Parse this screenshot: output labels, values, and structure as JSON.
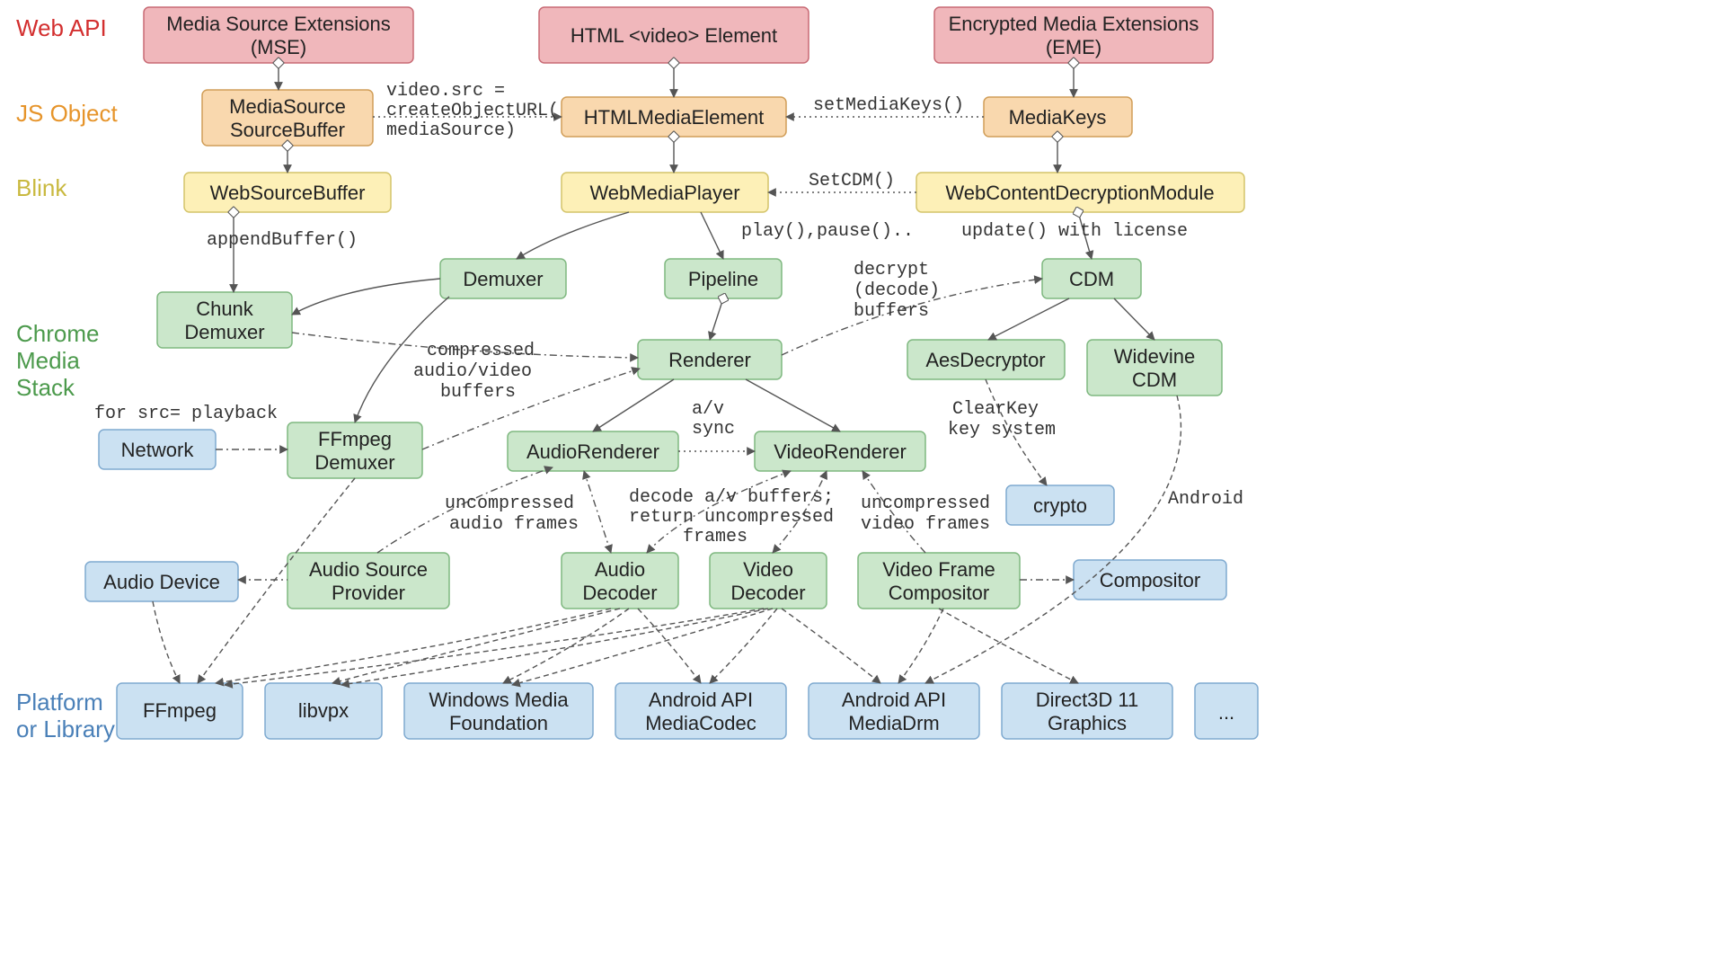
{
  "layers": {
    "webapi": "Web API",
    "jsobj": "JS Object",
    "blink": "Blink",
    "cms1": "Chrome",
    "cms2": "Media",
    "cms3": "Stack",
    "plat1": "Platform",
    "plat2": "or Library"
  },
  "boxes": {
    "mse1": "Media Source Extensions",
    "mse2": "(MSE)",
    "video": "HTML <video> Element",
    "eme1": "Encrypted Media Extensions",
    "eme2": "(EME)",
    "mssb1": "MediaSource",
    "mssb2": "SourceBuffer",
    "hme": "HTMLMediaElement",
    "mk": "MediaKeys",
    "wsb": "WebSourceBuffer",
    "wmp": "WebMediaPlayer",
    "wcdm": "WebContentDecryptionModule",
    "chunk1": "Chunk",
    "chunk2": "Demuxer",
    "demux": "Demuxer",
    "pipe": "Pipeline",
    "cdm": "CDM",
    "render": "Renderer",
    "aesd": "AesDecryptor",
    "wvcdm1": "Widevine",
    "wvcdm2": "CDM",
    "net": "Network",
    "ffdmx1": "FFmpeg",
    "ffdmx2": "Demuxer",
    "arend": "AudioRenderer",
    "vrend": "VideoRenderer",
    "crypto": "crypto",
    "adev": "Audio Device",
    "asp1": "Audio Source",
    "asp2": "Provider",
    "adec1": "Audio",
    "adec2": "Decoder",
    "vdec1": "Video",
    "vdec2": "Decoder",
    "vfc1": "Video Frame",
    "vfc2": "Compositor",
    "comp": "Compositor",
    "ffmpeg": "FFmpeg",
    "libvpx": "libvpx",
    "wmf1": "Windows Media",
    "wmf2": "Foundation",
    "amc1": "Android API",
    "amc2": "MediaCodec",
    "amd1": "Android API",
    "amd2": "MediaDrm",
    "d3d1": "Direct3D 11",
    "d3d2": "Graphics",
    "more": "..."
  },
  "edges": {
    "vsrc1": "video.src =",
    "vsrc2": "createObjectURL(",
    "vsrc3": "mediaSource)",
    "smk": "setMediaKeys()",
    "setcdm": "SetCDM()",
    "appendbuf": "appendBuffer()",
    "playpause": "play(),pause()..",
    "updlic": "update() with license",
    "srcplay": "for src= playback",
    "cmp1": "compressed",
    "cmp2": "audio/video",
    "cmp3": "buffers",
    "avsync1": "a/v",
    "avsync2": "sync",
    "ucaf1": "uncompressed",
    "ucaf2": "audio frames",
    "dec1": "decode a/v buffers;",
    "dec2": "return uncompressed",
    "dec3": "frames",
    "ucvf1": "uncompressed",
    "ucvf2": "video frames",
    "decd1": "decrypt",
    "decd2": "(decode)",
    "decd3": "buffers",
    "ck1": "ClearKey",
    "ck2": "key system",
    "android": "Android"
  }
}
